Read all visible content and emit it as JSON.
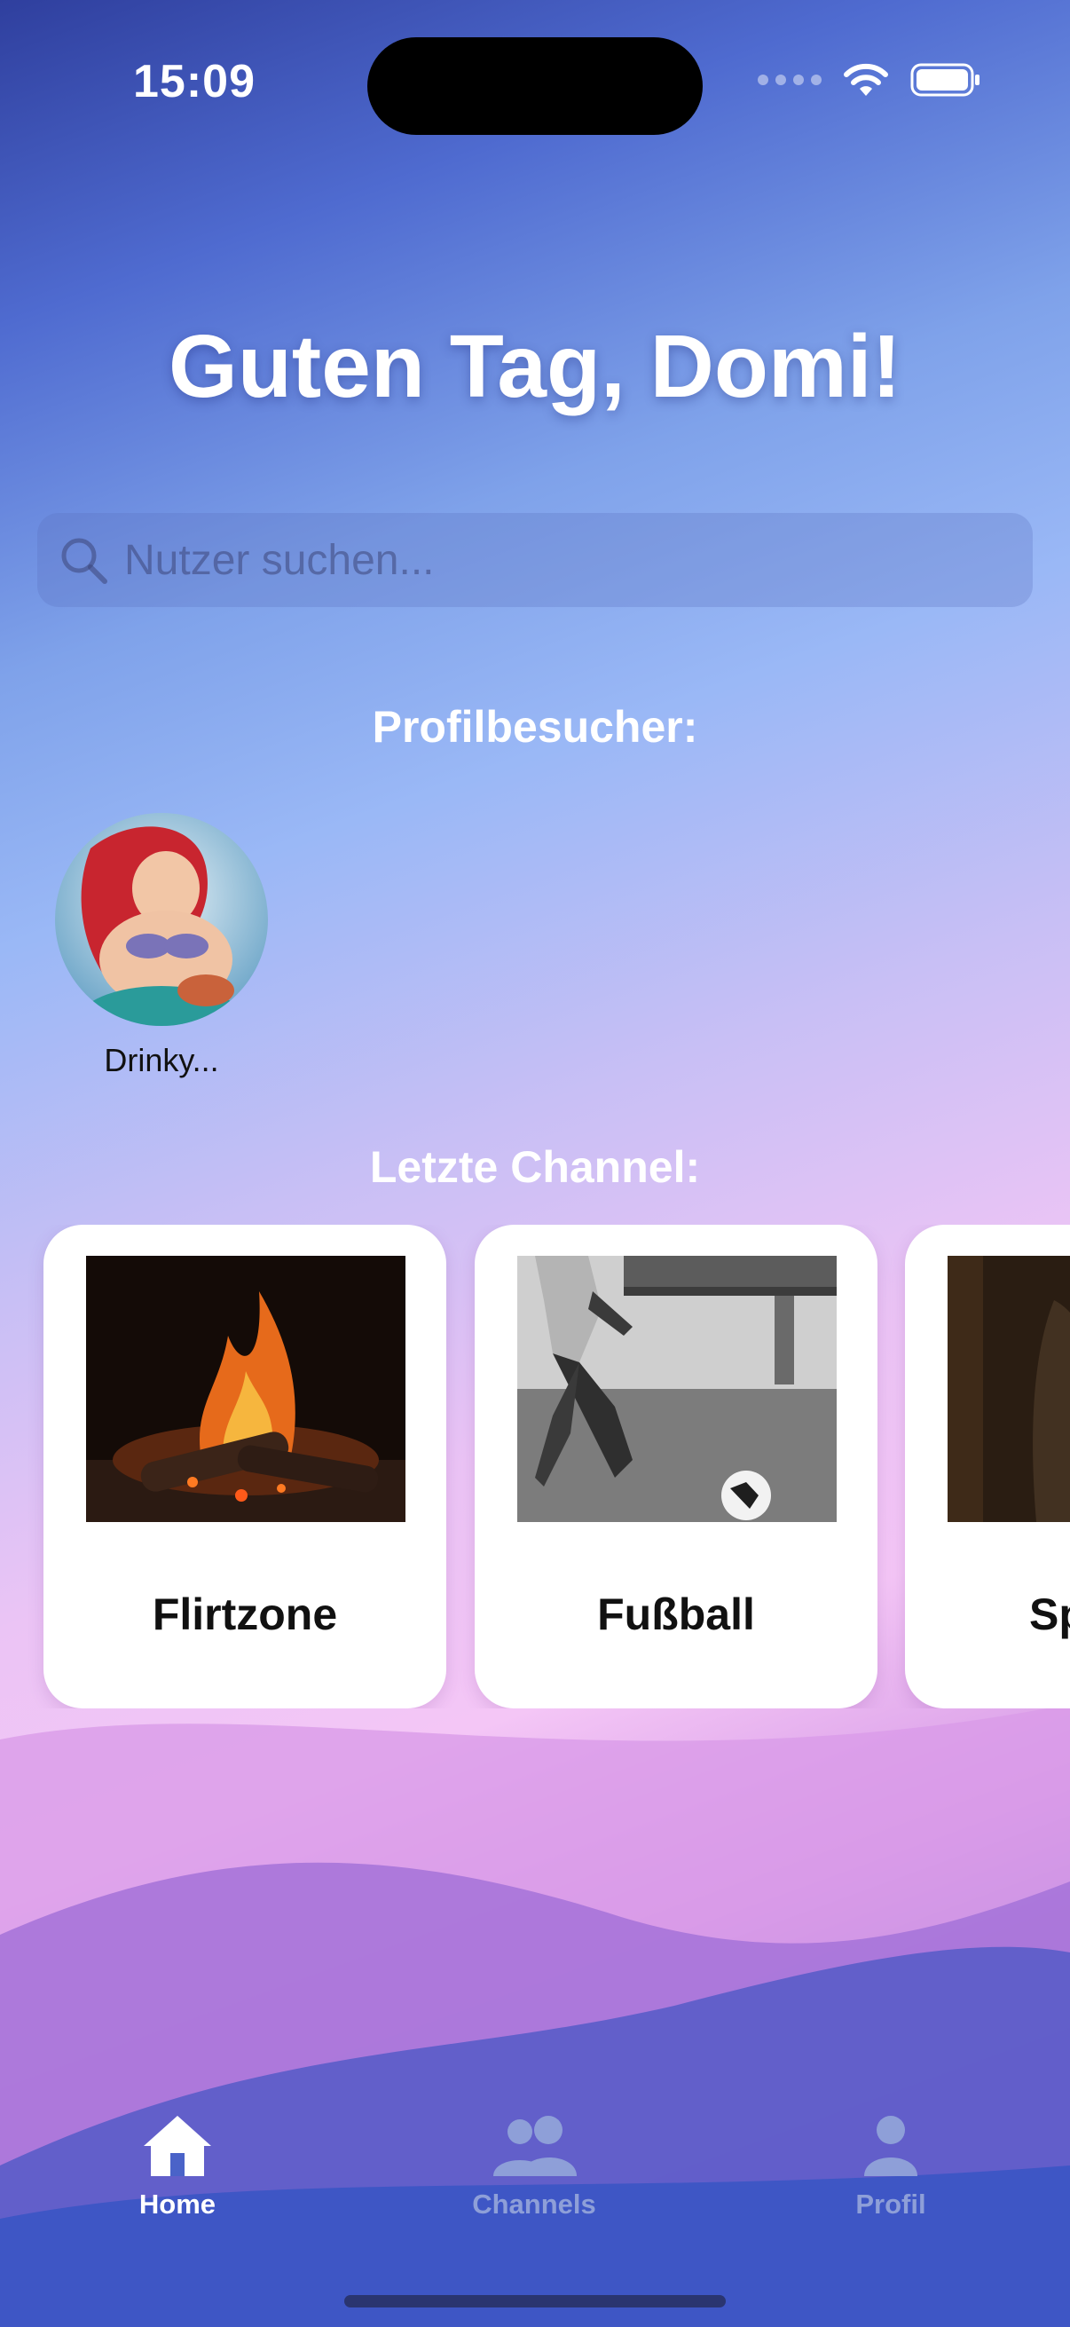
{
  "status_bar": {
    "time": "15:09",
    "icons": [
      "signal-icon",
      "wifi-icon",
      "battery-icon"
    ]
  },
  "greeting": "Guten Tag, Domi!",
  "search": {
    "placeholder": "Nutzer suchen..."
  },
  "visitors": {
    "title": "Profilbesucher:",
    "items": [
      {
        "name": "Drinky..."
      }
    ]
  },
  "channels": {
    "title": "Letzte Channel:",
    "items": [
      {
        "name": "Flirtzone"
      },
      {
        "name": "Fußball"
      },
      {
        "name": "Sp"
      }
    ]
  },
  "tabs": [
    {
      "label": "Home",
      "icon": "home-icon",
      "active": true
    },
    {
      "label": "Channels",
      "icon": "people-icon",
      "active": false
    },
    {
      "label": "Profil",
      "icon": "person-icon",
      "active": false
    }
  ],
  "colors": {
    "active_tab": "#ffffff",
    "inactive_tab": "#8e9fd8"
  }
}
